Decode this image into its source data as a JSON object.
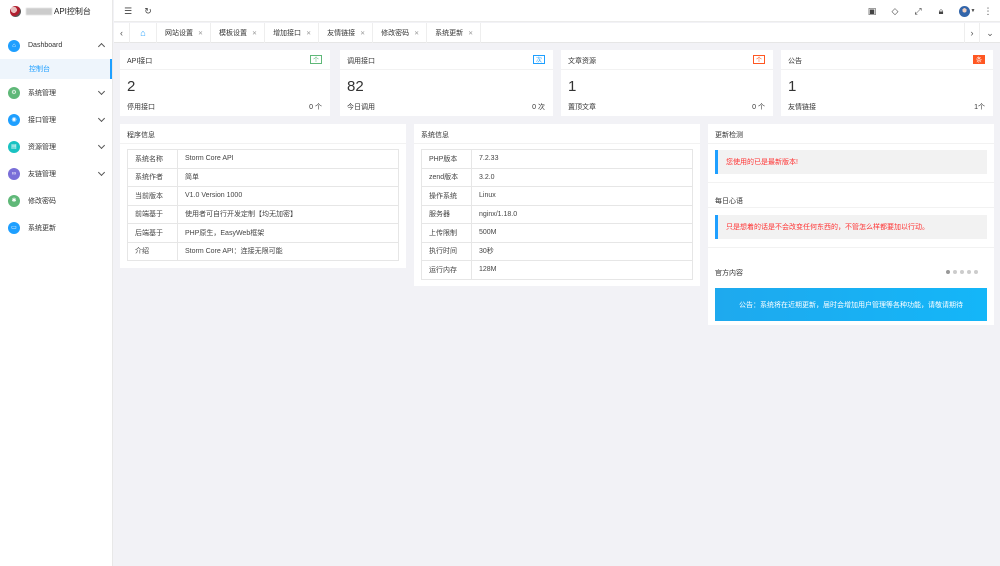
{
  "app": {
    "title": "API控制台"
  },
  "sidebar": {
    "items": [
      {
        "label": "Dashboard",
        "icon": "home-icon",
        "color": "#1e9fff",
        "glyph": "⌂",
        "expanded": true
      },
      {
        "label": "系统管理",
        "icon": "gear-icon",
        "color": "#5fb878",
        "glyph": "⚙"
      },
      {
        "label": "接口管理",
        "icon": "api-icon",
        "color": "#1e9fff",
        "glyph": "◉"
      },
      {
        "label": "资源管理",
        "icon": "folder-icon",
        "color": "#19c2c2",
        "glyph": "▤"
      },
      {
        "label": "友链管理",
        "icon": "link-icon",
        "color": "#7a6fd8",
        "glyph": "∞"
      },
      {
        "label": "修改密码",
        "icon": "key-icon",
        "color": "#5fb878",
        "glyph": "✱"
      },
      {
        "label": "系统更新",
        "icon": "update-icon",
        "color": "#1e9fff",
        "glyph": "▭"
      }
    ],
    "active_sub": "控制台"
  },
  "tabs": [
    {
      "label": "网站设置"
    },
    {
      "label": "模板设置"
    },
    {
      "label": "增加接口"
    },
    {
      "label": "友情链接"
    },
    {
      "label": "修改密码"
    },
    {
      "label": "系统更新"
    }
  ],
  "stats": [
    {
      "title": "API接口",
      "badge": "个",
      "badge_color": "#5fb878",
      "value": "2",
      "label": "停用接口",
      "unit": "0 个"
    },
    {
      "title": "调用接口",
      "badge": "次",
      "badge_color": "#1e9fff",
      "value": "82",
      "label": "今日调用",
      "unit": "0 次"
    },
    {
      "title": "文章资源",
      "badge": "个",
      "badge_color": "#ff5722",
      "value": "1",
      "label": "置顶文章",
      "unit": "0 个"
    },
    {
      "title": "公告",
      "badge": "条",
      "badge_color": "#ff5722",
      "value": "1",
      "label": "友情链接",
      "unit": "1个"
    }
  ],
  "program_info": {
    "title": "程序信息",
    "rows": [
      {
        "key": "系统名称",
        "value": "Storm Core API"
      },
      {
        "key": "系统作者",
        "value": "简单"
      },
      {
        "key": "当前版本",
        "value": "V1.0 Version 1000"
      },
      {
        "key": "前端基于",
        "value": "使用者可自行开发定制【均无加密】"
      },
      {
        "key": "后端基于",
        "value": "PHP原生，EasyWeb框架"
      },
      {
        "key": "介绍",
        "value": "Storm Core API：连接无限可能"
      }
    ]
  },
  "system_info": {
    "title": "系统信息",
    "rows": [
      {
        "key": "PHP版本",
        "value": "7.2.33"
      },
      {
        "key": "zend版本",
        "value": "3.2.0"
      },
      {
        "key": "操作系统",
        "value": "Linux"
      },
      {
        "key": "服务器",
        "value": "nginx/1.18.0"
      },
      {
        "key": "上传限制",
        "value": "500M"
      },
      {
        "key": "执行时间",
        "value": "30秒"
      },
      {
        "key": "运行内存",
        "value": "128M"
      }
    ]
  },
  "update_check": {
    "title": "更新检测",
    "message": "您使用的已是最新版本!"
  },
  "daily": {
    "title": "每日心语",
    "message": "只是想着的话是不会改变任何东西的，不管怎么样都要加以行动。"
  },
  "official": {
    "title": "官方内容",
    "notice": "公告：系统将在近期更新，届时会增加用户管理等各种功能，请敬请期待",
    "slides": 5,
    "active_slide": 0
  },
  "colors": {
    "accent": "#1e9fff",
    "alert_text": "#ff3333"
  }
}
